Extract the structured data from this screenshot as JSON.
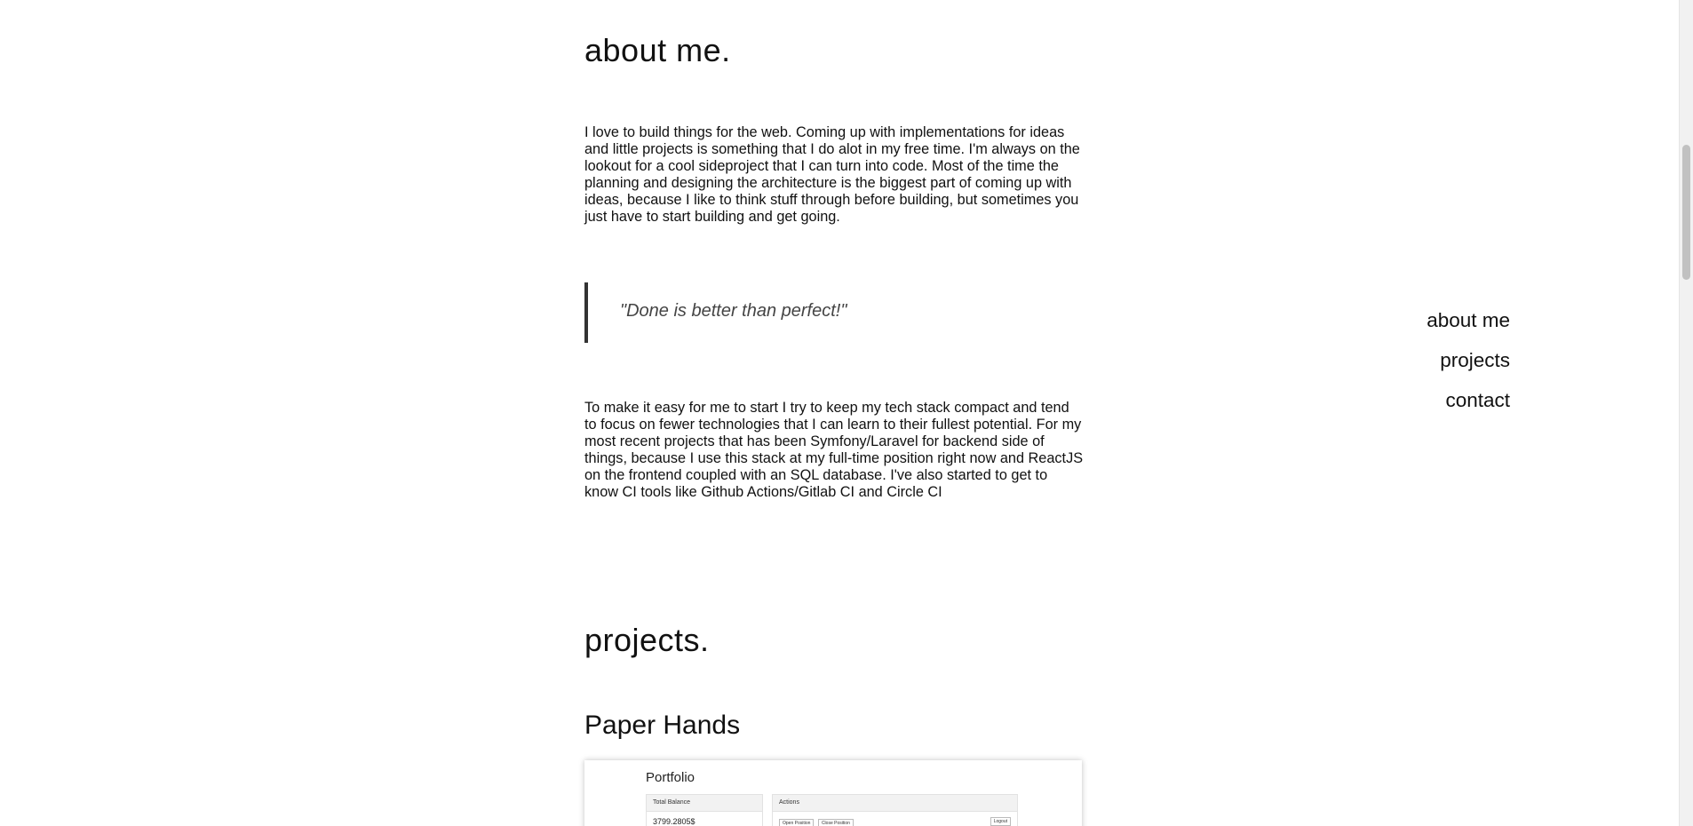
{
  "about": {
    "title": "about me.",
    "paragraph1": "I love to build things for the web. Coming up with implementations for ideas and little projects is something that I do alot in my free time. I'm always on the lookout for a cool sideproject that I can turn into code. Most of the time the planning and designing the architecture is the biggest part of coming up with ideas, because I like to think stuff through before building, but sometimes you just have to start building and get going.",
    "quote": "\"Done is better than perfect!\"",
    "paragraph2": "To make it easy for me to start I try to keep my tech stack compact and tend to focus on fewer technologies that I can learn to their fullest potential. For my most recent projects that has been Symfony/Laravel for backend side of things, because I use this stack at my full-time position right now and ReactJS on the frontend coupled with an SQL database. I've also started to get to know CI tools like Github Actions/Gitlab CI and Circle CI"
  },
  "projects": {
    "title": "projects.",
    "items": [
      {
        "name": "Paper Hands",
        "preview": {
          "heading": "Portfolio",
          "balance_label": "Total Balance",
          "balance_value": "3799.2805$",
          "actions_label": "Actions",
          "open_position": "Open Position",
          "close_position": "Close Position",
          "logout": "Logout"
        }
      }
    ]
  },
  "nav": {
    "items": [
      "about me",
      "projects",
      "contact"
    ]
  }
}
